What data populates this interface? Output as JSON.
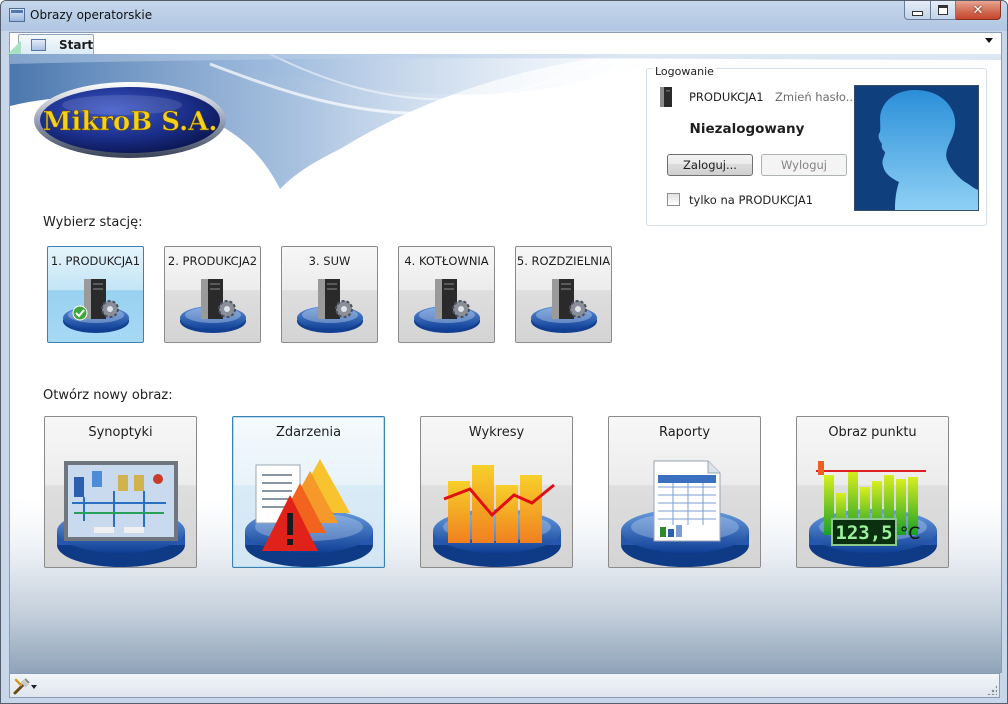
{
  "window": {
    "title": "Obrazy operatorskie",
    "controls": {
      "minimize": "minimize",
      "maximize": "maximize",
      "close": "✕"
    }
  },
  "tabs": [
    {
      "label": "Start",
      "active": true
    }
  ],
  "brand": {
    "logo_text": "MikroB S.A."
  },
  "stations": {
    "label": "Wybierz stację:",
    "items": [
      {
        "label": "1. PRODUKCJA1",
        "selected": true,
        "icon": "server-ok-icon"
      },
      {
        "label": "2. PRODUKCJA2",
        "selected": false,
        "icon": "server-icon"
      },
      {
        "label": "3. SUW",
        "selected": false,
        "icon": "server-icon"
      },
      {
        "label": "4. KOTŁOWNIA",
        "selected": false,
        "icon": "server-icon"
      },
      {
        "label": "5. ROZDZIELNIA",
        "selected": false,
        "icon": "server-icon"
      }
    ]
  },
  "views": {
    "label": "Otwórz nowy obraz:",
    "items": [
      {
        "label": "Synoptyki",
        "icon": "synoptic-icon"
      },
      {
        "label": "Zdarzenia",
        "icon": "events-warning-icon"
      },
      {
        "label": "Wykresy",
        "icon": "chart-icon"
      },
      {
        "label": "Raporty",
        "icon": "report-icon"
      },
      {
        "label": "Obraz punktu",
        "icon": "point-gauge-icon",
        "reading": "123,5",
        "unit": "°C"
      }
    ]
  },
  "login": {
    "legend": "Logowanie",
    "station": "PRODUKCJA1",
    "change_password": "Zmień hasło...",
    "status": "Niezalogowany",
    "login_button": "Zaloguj...",
    "logout_button": "Wyloguj",
    "only_checkbox_label": "tylko na PRODUKCJA1",
    "only_checkbox_checked": false
  },
  "colors": {
    "accent": "#3c7fb1",
    "selected_station": "#a7d9f5",
    "logo_bg": "#1b2f8a",
    "logo_text": "#f2d21d",
    "avatar_bg": "#0f3f7c"
  }
}
